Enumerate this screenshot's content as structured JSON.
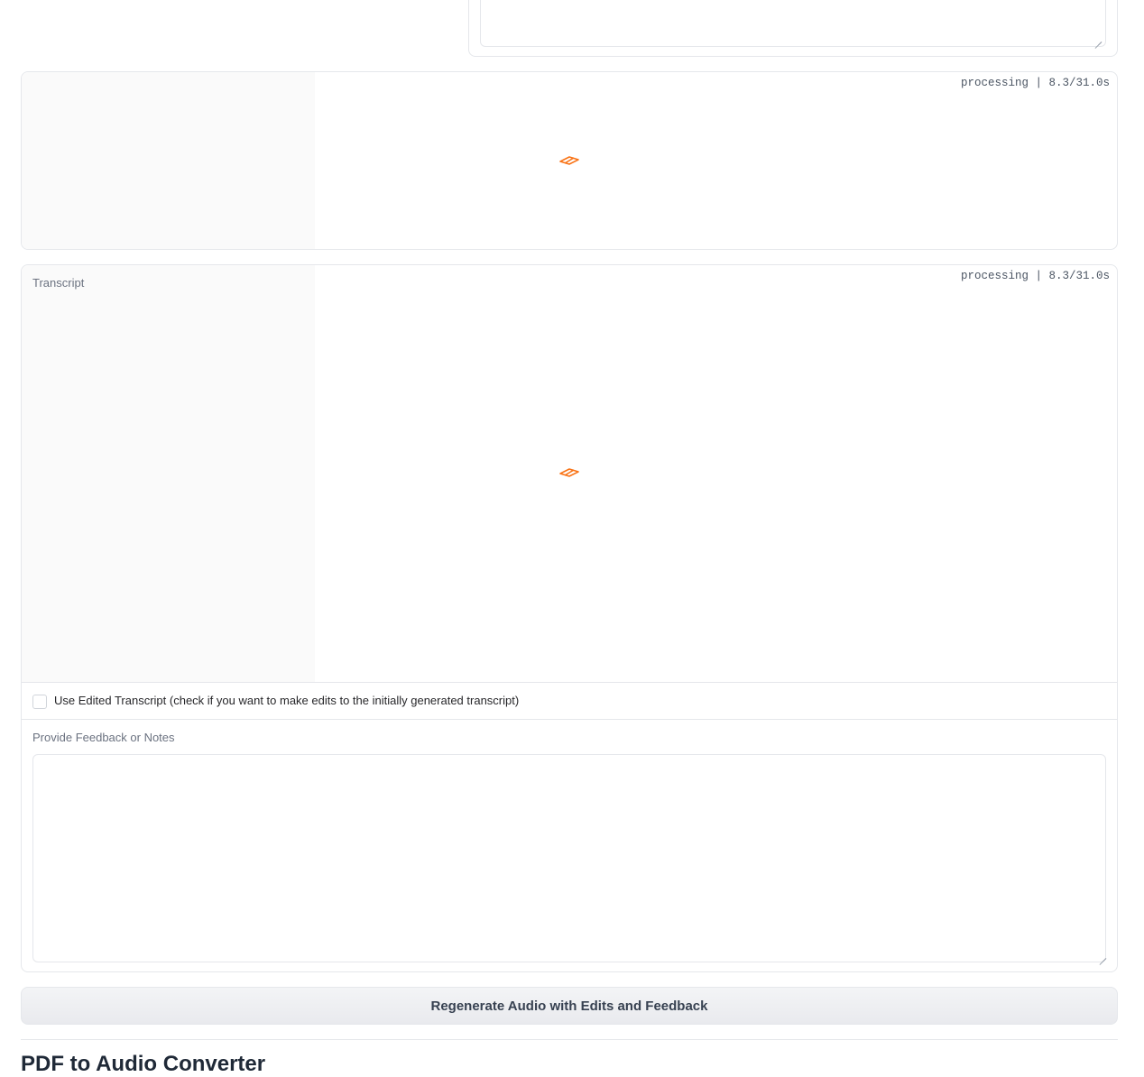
{
  "audio_panel": {
    "status": "processing | 8.3/31.0s"
  },
  "transcript_panel": {
    "label": "Transcript",
    "status": "processing | 8.3/31.0s"
  },
  "edited_transcript": {
    "label": "Use Edited Transcript (check if you want to make edits to the initially generated transcript)",
    "checked": false
  },
  "feedback": {
    "label": "Provide Feedback or Notes",
    "value": "",
    "placeholder": ""
  },
  "regenerate_button": {
    "label": "Regenerate Audio with Edits and Feedback"
  },
  "page_heading": "PDF to Audio Converter",
  "colors": {
    "accent": "#f97316",
    "border": "#e5e7eb",
    "panel_shade": "#fafafa"
  },
  "icons": {
    "loading": "loading-spinner-icon"
  }
}
